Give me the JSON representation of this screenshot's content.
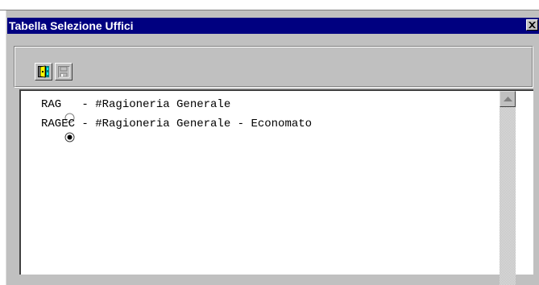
{
  "window": {
    "title": "Tabella Selezione Uffici"
  },
  "toolbar": {
    "buttons": [
      {
        "icon": "exit-door-icon",
        "enabled": true
      },
      {
        "icon": "save-disk-icon",
        "enabled": false
      }
    ]
  },
  "list": {
    "items": [
      {
        "text": "RAG   - #Ragioneria Generale",
        "selected": false
      },
      {
        "text": "RAGEC - #Ragioneria Generale - Economato",
        "selected": true
      }
    ]
  },
  "colors": {
    "titlebar": "#000080",
    "face": "#c0c0c0",
    "list_bg": "#ffffff"
  }
}
